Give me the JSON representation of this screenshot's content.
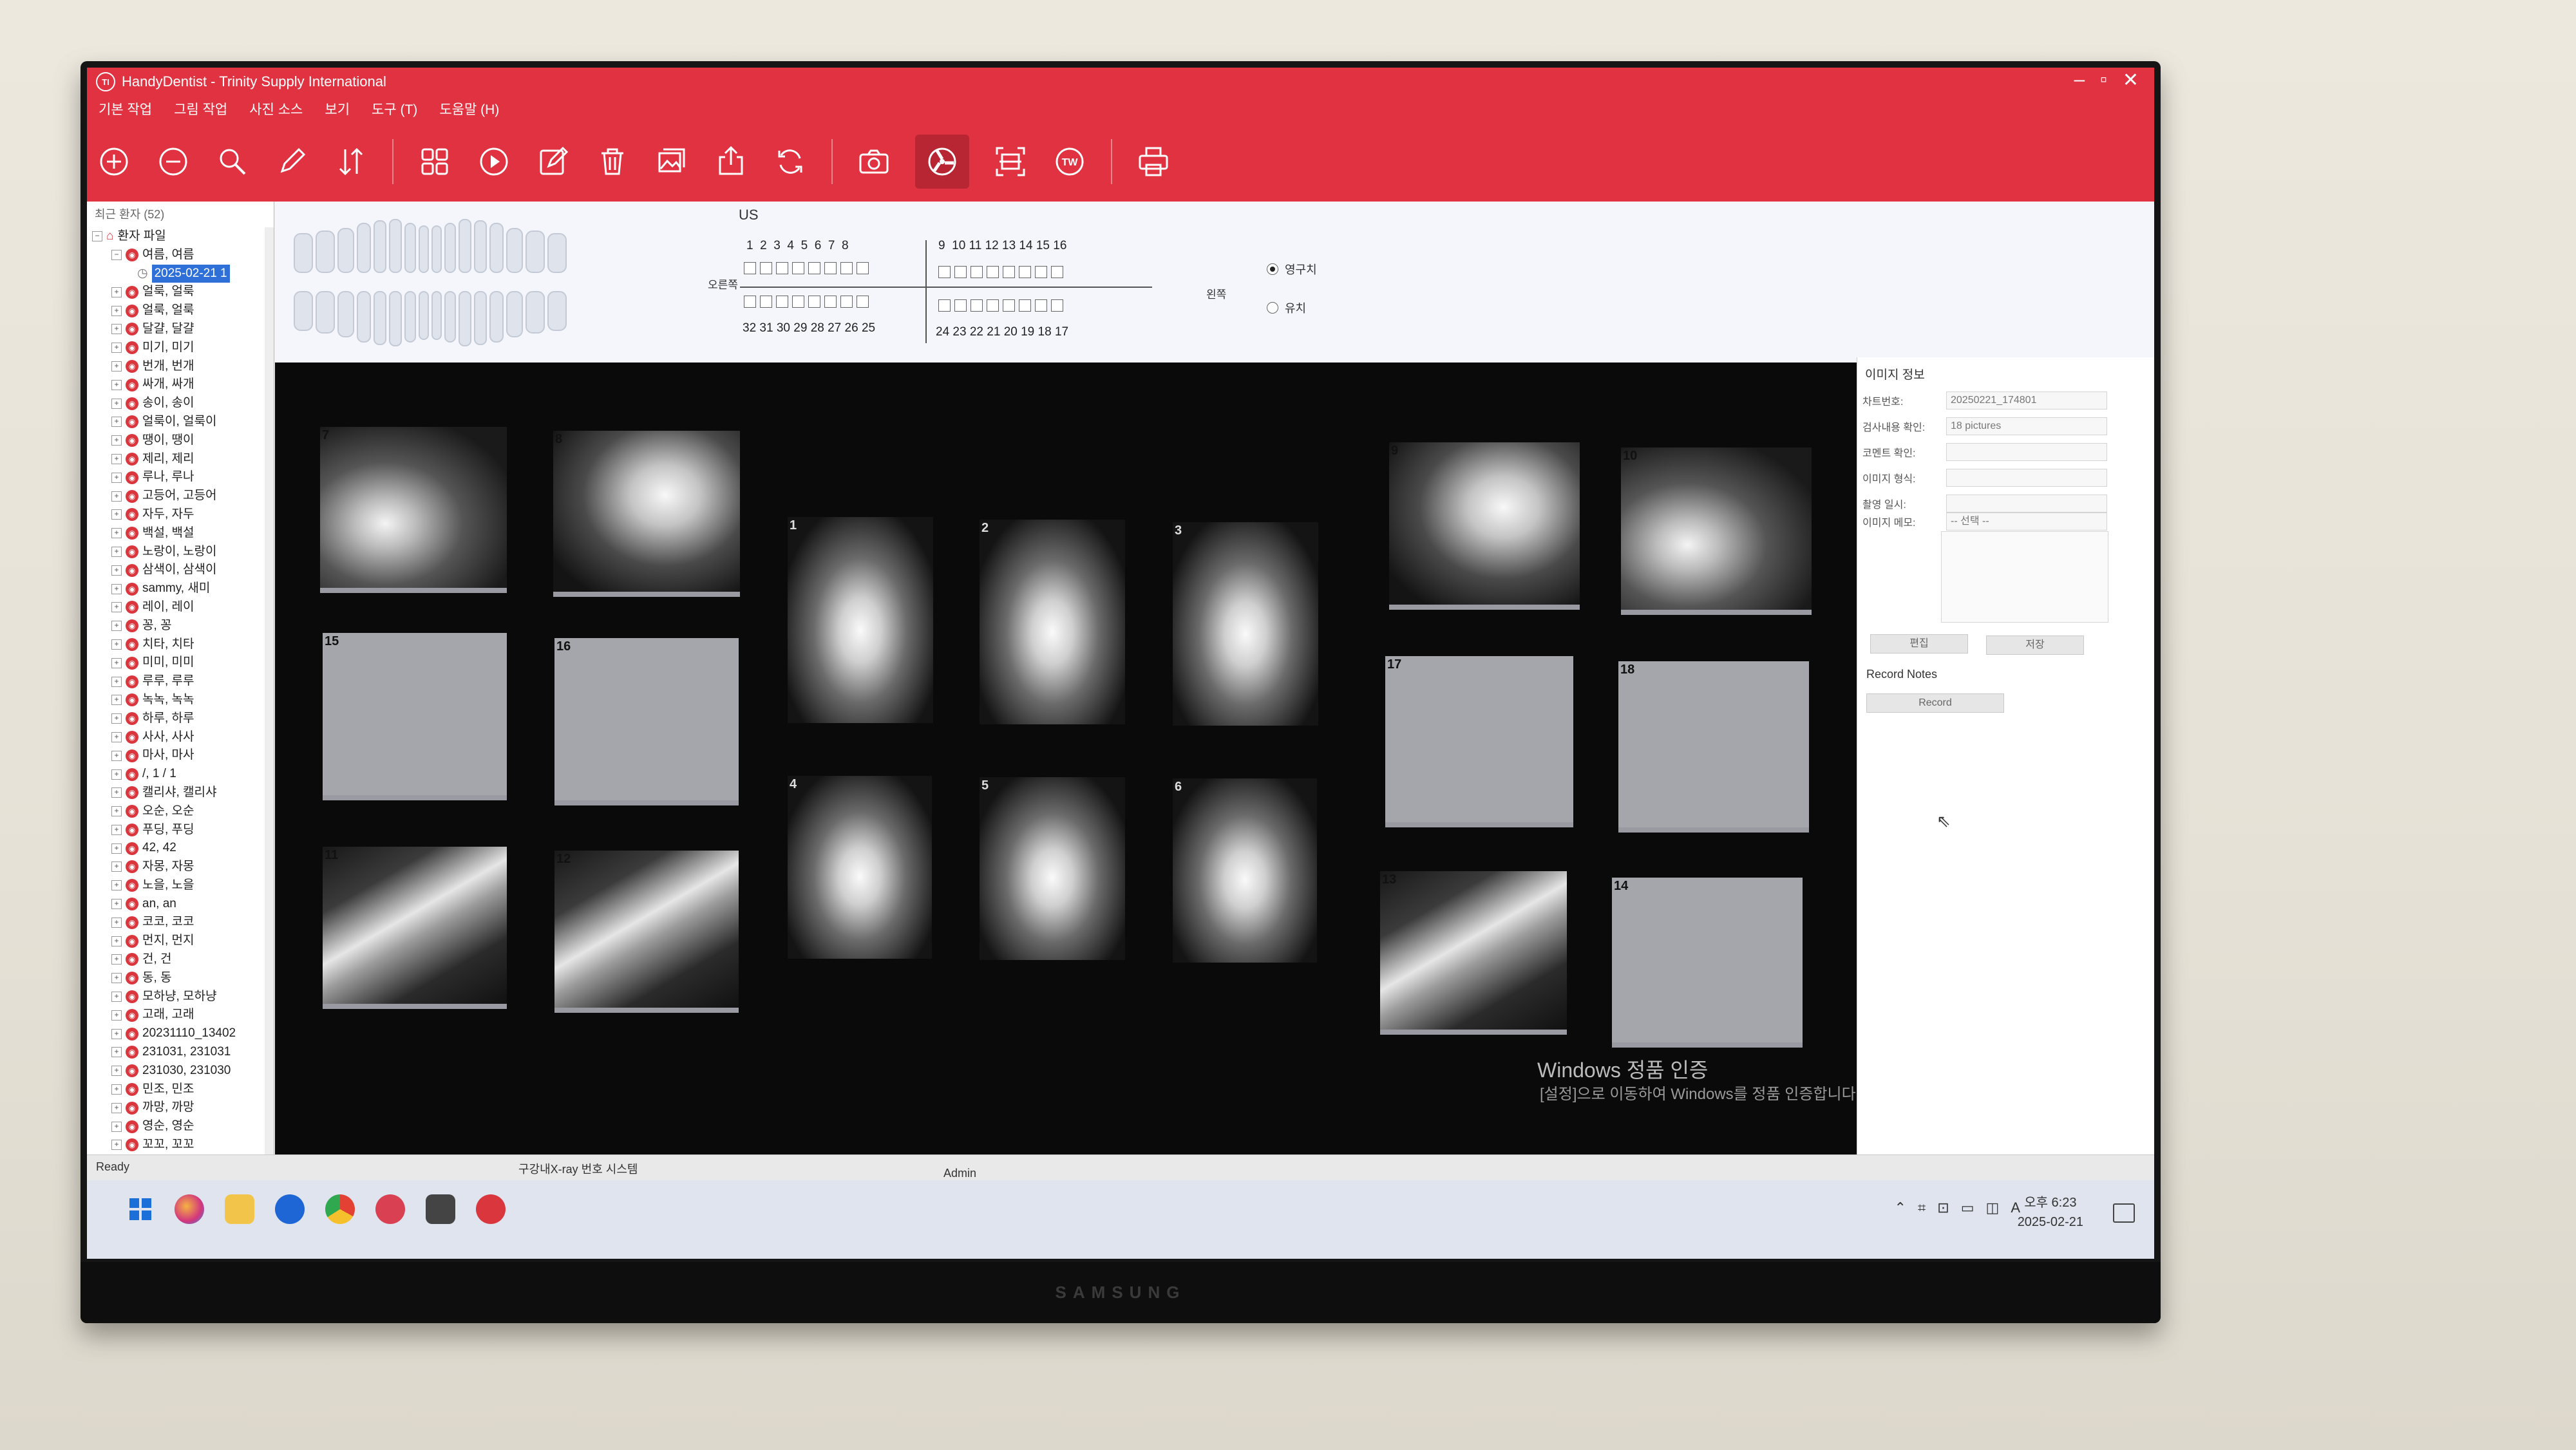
{
  "window": {
    "title": "HandyDentist - Trinity Supply International",
    "app_icon_letter": "TI"
  },
  "menu": [
    "기본 작업",
    "그림 작업",
    "사진 소스",
    "보기",
    "도구 (T)",
    "도움말 (H)"
  ],
  "toolbar_icons": [
    "zoom-in-icon",
    "zoom-out-icon",
    "search-icon",
    "pencil-icon",
    "sort-icon",
    "grid-icon",
    "play-icon",
    "edit-icon",
    "trash-icon",
    "gallery-icon",
    "export-icon",
    "refresh-icon",
    "camera-icon",
    "xray-source-icon",
    "scan-icon",
    "tw-icon",
    "print-icon"
  ],
  "toolbar_tw_label": "TW",
  "patients": {
    "header": "최근 환자 (52)",
    "root": "환자 파일",
    "expanded": "여름, 여름",
    "selected_date": "2025-02-21 1",
    "list": [
      "얼룩, 얼룩",
      "얼룩, 얼룩",
      "달걀, 달걀",
      "미기, 미기",
      "번개, 번개",
      "싸개, 싸개",
      "송이, 송이",
      "얼룩이, 얼룩이",
      "땡이, 땡이",
      "제리, 제리",
      "루나, 루나",
      "고등어, 고등어",
      "자두, 자두",
      "백설, 백설",
      "노랑이, 노랑이",
      "삼색이, 삼색이",
      "sammy, 새미",
      "레이, 레이",
      "꽁, 꽁",
      "치타, 치타",
      "미미, 미미",
      "루루, 루루",
      "녹녹, 녹녹",
      "하루, 하루",
      "사사, 사사",
      "마사, 마사",
      "/, 1 / 1",
      "캘리샤, 캘리샤",
      "오순, 오순",
      "푸딩, 푸딩",
      "42, 42",
      "자몽, 자몽",
      "노을, 노을",
      "an, an",
      "코코, 코코",
      "먼지, 먼지",
      "건, 건",
      "동, 동",
      "모하냥, 모하냥",
      "고래, 고래",
      "20231110_13402",
      "231031, 231031",
      "231030, 231030",
      "민조, 민조",
      "까망, 까망",
      "영순, 영순",
      "꼬꼬, 꼬꼬"
    ]
  },
  "dental_chart": {
    "label": "US",
    "upper_right": [
      "1",
      "2",
      "3",
      "4",
      "5",
      "6",
      "7",
      "8"
    ],
    "upper_left": [
      "9",
      "10",
      "11",
      "12",
      "13",
      "14",
      "15",
      "16"
    ],
    "lower_right": [
      "32",
      "31",
      "30",
      "29",
      "28",
      "27",
      "26",
      "25"
    ],
    "lower_left": [
      "24",
      "23",
      "22",
      "21",
      "20",
      "19",
      "18",
      "17"
    ],
    "right_side": "오른쪽",
    "left_side": "왼쪽",
    "options": [
      {
        "label": "영구치",
        "checked": true
      },
      {
        "label": "유치",
        "checked": false
      }
    ]
  },
  "images": {
    "slots": [
      "7",
      "8",
      "15",
      "16",
      "11",
      "12",
      "1",
      "2",
      "3",
      "4",
      "5",
      "6",
      "9",
      "10",
      "17",
      "18",
      "13",
      "14"
    ],
    "watermark": {
      "title": "Windows 정품 인증",
      "subtitle": "[설정]으로 이동하여 Windows를 정품 인증합니다."
    }
  },
  "image_info": {
    "title": "이미지 정보",
    "fields": [
      {
        "label": "차트번호:",
        "value": "20250221_174801"
      },
      {
        "label": "검사내용 확인:",
        "value": "18 pictures"
      },
      {
        "label": "코멘트 확인:",
        "value": ""
      },
      {
        "label": "이미지 형식:",
        "value": ""
      },
      {
        "label": "촬영 일시:",
        "value": ""
      },
      {
        "label": "이미지 메모:",
        "value": "-- 선택 --"
      }
    ],
    "edit_button": "편집",
    "save_button": "저장",
    "record_notes_label": "Record Notes",
    "record_button": "Record"
  },
  "status": {
    "left": "Ready",
    "system": "구강내X-ray 번호 시스템",
    "user": "Admin"
  },
  "taskbar": {
    "time": "오후 6:23",
    "date": "2025-02-21",
    "ime": "A"
  },
  "monitor_brand": "SAMSUNG"
}
